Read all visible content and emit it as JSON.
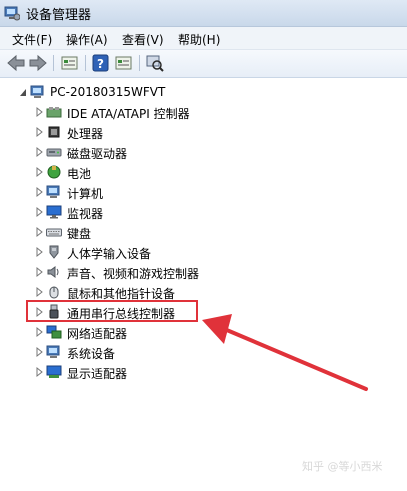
{
  "window": {
    "title": "设备管理器"
  },
  "menu": [
    "文件(F)",
    "操作(A)",
    "查看(V)",
    "帮助(H)"
  ],
  "toolbar": [
    "back-icon",
    "forward-icon",
    "properties-icon",
    "help-icon",
    "view-icon",
    "scan-hardware-icon"
  ],
  "tree": {
    "root": "PC-20180315WFVT",
    "items": [
      "IDE ATA/ATAPI 控制器",
      "处理器",
      "磁盘驱动器",
      "电池",
      "计算机",
      "监视器",
      "键盘",
      "人体学输入设备",
      "声音、视频和游戏控制器",
      "鼠标和其他指针设备",
      "通用串行总线控制器",
      "网络适配器",
      "系统设备",
      "显示适配器"
    ]
  },
  "highlight": {
    "item": "通用串行总线控制器",
    "color": "#e0323a"
  },
  "watermark": "知乎 @等小西米"
}
